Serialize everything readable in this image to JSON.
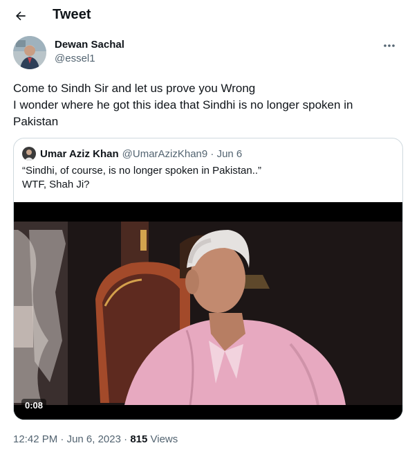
{
  "header": {
    "title": "Tweet",
    "back_icon": "arrow-left-icon"
  },
  "tweet": {
    "author_name": "Dewan Sachal",
    "author_handle": "@essel1",
    "more_icon": "ellipsis-icon",
    "text_line1": "Come to Sindh Sir and let us prove you Wrong",
    "text_line2": "I wonder where he got this idea that Sindhi is no longer spoken in Pakistan",
    "time": "12:42 PM",
    "sep1": "·",
    "date": "Jun 6, 2023",
    "sep2": "·",
    "views_count": "815",
    "views_label": "Views"
  },
  "quote": {
    "author_name": "Umar Aziz Khan",
    "handle_date": "@UmarAzizKhan9 · Jun 6",
    "line1": "“Sindhi, of course, is no longer spoken in Pakistan..”",
    "line2": "WTF, Shah Ji?",
    "video_duration": "0:08"
  },
  "colors": {
    "text": "#0f1419",
    "muted": "#536471",
    "border": "#cfd9de",
    "shirt": "#e7a9c0"
  }
}
